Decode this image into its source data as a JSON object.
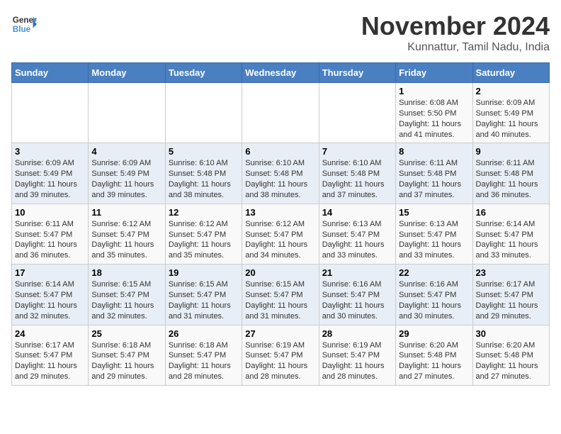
{
  "header": {
    "logo_line1": "General",
    "logo_line2": "Blue",
    "title": "November 2024",
    "location": "Kunnattur, Tamil Nadu, India"
  },
  "weekdays": [
    "Sunday",
    "Monday",
    "Tuesday",
    "Wednesday",
    "Thursday",
    "Friday",
    "Saturday"
  ],
  "weeks": [
    [
      {
        "day": "",
        "info": ""
      },
      {
        "day": "",
        "info": ""
      },
      {
        "day": "",
        "info": ""
      },
      {
        "day": "",
        "info": ""
      },
      {
        "day": "",
        "info": ""
      },
      {
        "day": "1",
        "info": "Sunrise: 6:08 AM\nSunset: 5:50 PM\nDaylight: 11 hours\nand 41 minutes."
      },
      {
        "day": "2",
        "info": "Sunrise: 6:09 AM\nSunset: 5:49 PM\nDaylight: 11 hours\nand 40 minutes."
      }
    ],
    [
      {
        "day": "3",
        "info": "Sunrise: 6:09 AM\nSunset: 5:49 PM\nDaylight: 11 hours\nand 39 minutes."
      },
      {
        "day": "4",
        "info": "Sunrise: 6:09 AM\nSunset: 5:49 PM\nDaylight: 11 hours\nand 39 minutes."
      },
      {
        "day": "5",
        "info": "Sunrise: 6:10 AM\nSunset: 5:48 PM\nDaylight: 11 hours\nand 38 minutes."
      },
      {
        "day": "6",
        "info": "Sunrise: 6:10 AM\nSunset: 5:48 PM\nDaylight: 11 hours\nand 38 minutes."
      },
      {
        "day": "7",
        "info": "Sunrise: 6:10 AM\nSunset: 5:48 PM\nDaylight: 11 hours\nand 37 minutes."
      },
      {
        "day": "8",
        "info": "Sunrise: 6:11 AM\nSunset: 5:48 PM\nDaylight: 11 hours\nand 37 minutes."
      },
      {
        "day": "9",
        "info": "Sunrise: 6:11 AM\nSunset: 5:48 PM\nDaylight: 11 hours\nand 36 minutes."
      }
    ],
    [
      {
        "day": "10",
        "info": "Sunrise: 6:11 AM\nSunset: 5:47 PM\nDaylight: 11 hours\nand 36 minutes."
      },
      {
        "day": "11",
        "info": "Sunrise: 6:12 AM\nSunset: 5:47 PM\nDaylight: 11 hours\nand 35 minutes."
      },
      {
        "day": "12",
        "info": "Sunrise: 6:12 AM\nSunset: 5:47 PM\nDaylight: 11 hours\nand 35 minutes."
      },
      {
        "day": "13",
        "info": "Sunrise: 6:12 AM\nSunset: 5:47 PM\nDaylight: 11 hours\nand 34 minutes."
      },
      {
        "day": "14",
        "info": "Sunrise: 6:13 AM\nSunset: 5:47 PM\nDaylight: 11 hours\nand 33 minutes."
      },
      {
        "day": "15",
        "info": "Sunrise: 6:13 AM\nSunset: 5:47 PM\nDaylight: 11 hours\nand 33 minutes."
      },
      {
        "day": "16",
        "info": "Sunrise: 6:14 AM\nSunset: 5:47 PM\nDaylight: 11 hours\nand 33 minutes."
      }
    ],
    [
      {
        "day": "17",
        "info": "Sunrise: 6:14 AM\nSunset: 5:47 PM\nDaylight: 11 hours\nand 32 minutes."
      },
      {
        "day": "18",
        "info": "Sunrise: 6:15 AM\nSunset: 5:47 PM\nDaylight: 11 hours\nand 32 minutes."
      },
      {
        "day": "19",
        "info": "Sunrise: 6:15 AM\nSunset: 5:47 PM\nDaylight: 11 hours\nand 31 minutes."
      },
      {
        "day": "20",
        "info": "Sunrise: 6:15 AM\nSunset: 5:47 PM\nDaylight: 11 hours\nand 31 minutes."
      },
      {
        "day": "21",
        "info": "Sunrise: 6:16 AM\nSunset: 5:47 PM\nDaylight: 11 hours\nand 30 minutes."
      },
      {
        "day": "22",
        "info": "Sunrise: 6:16 AM\nSunset: 5:47 PM\nDaylight: 11 hours\nand 30 minutes."
      },
      {
        "day": "23",
        "info": "Sunrise: 6:17 AM\nSunset: 5:47 PM\nDaylight: 11 hours\nand 29 minutes."
      }
    ],
    [
      {
        "day": "24",
        "info": "Sunrise: 6:17 AM\nSunset: 5:47 PM\nDaylight: 11 hours\nand 29 minutes."
      },
      {
        "day": "25",
        "info": "Sunrise: 6:18 AM\nSunset: 5:47 PM\nDaylight: 11 hours\nand 29 minutes."
      },
      {
        "day": "26",
        "info": "Sunrise: 6:18 AM\nSunset: 5:47 PM\nDaylight: 11 hours\nand 28 minutes."
      },
      {
        "day": "27",
        "info": "Sunrise: 6:19 AM\nSunset: 5:47 PM\nDaylight: 11 hours\nand 28 minutes."
      },
      {
        "day": "28",
        "info": "Sunrise: 6:19 AM\nSunset: 5:47 PM\nDaylight: 11 hours\nand 28 minutes."
      },
      {
        "day": "29",
        "info": "Sunrise: 6:20 AM\nSunset: 5:48 PM\nDaylight: 11 hours\nand 27 minutes."
      },
      {
        "day": "30",
        "info": "Sunrise: 6:20 AM\nSunset: 5:48 PM\nDaylight: 11 hours\nand 27 minutes."
      }
    ]
  ]
}
